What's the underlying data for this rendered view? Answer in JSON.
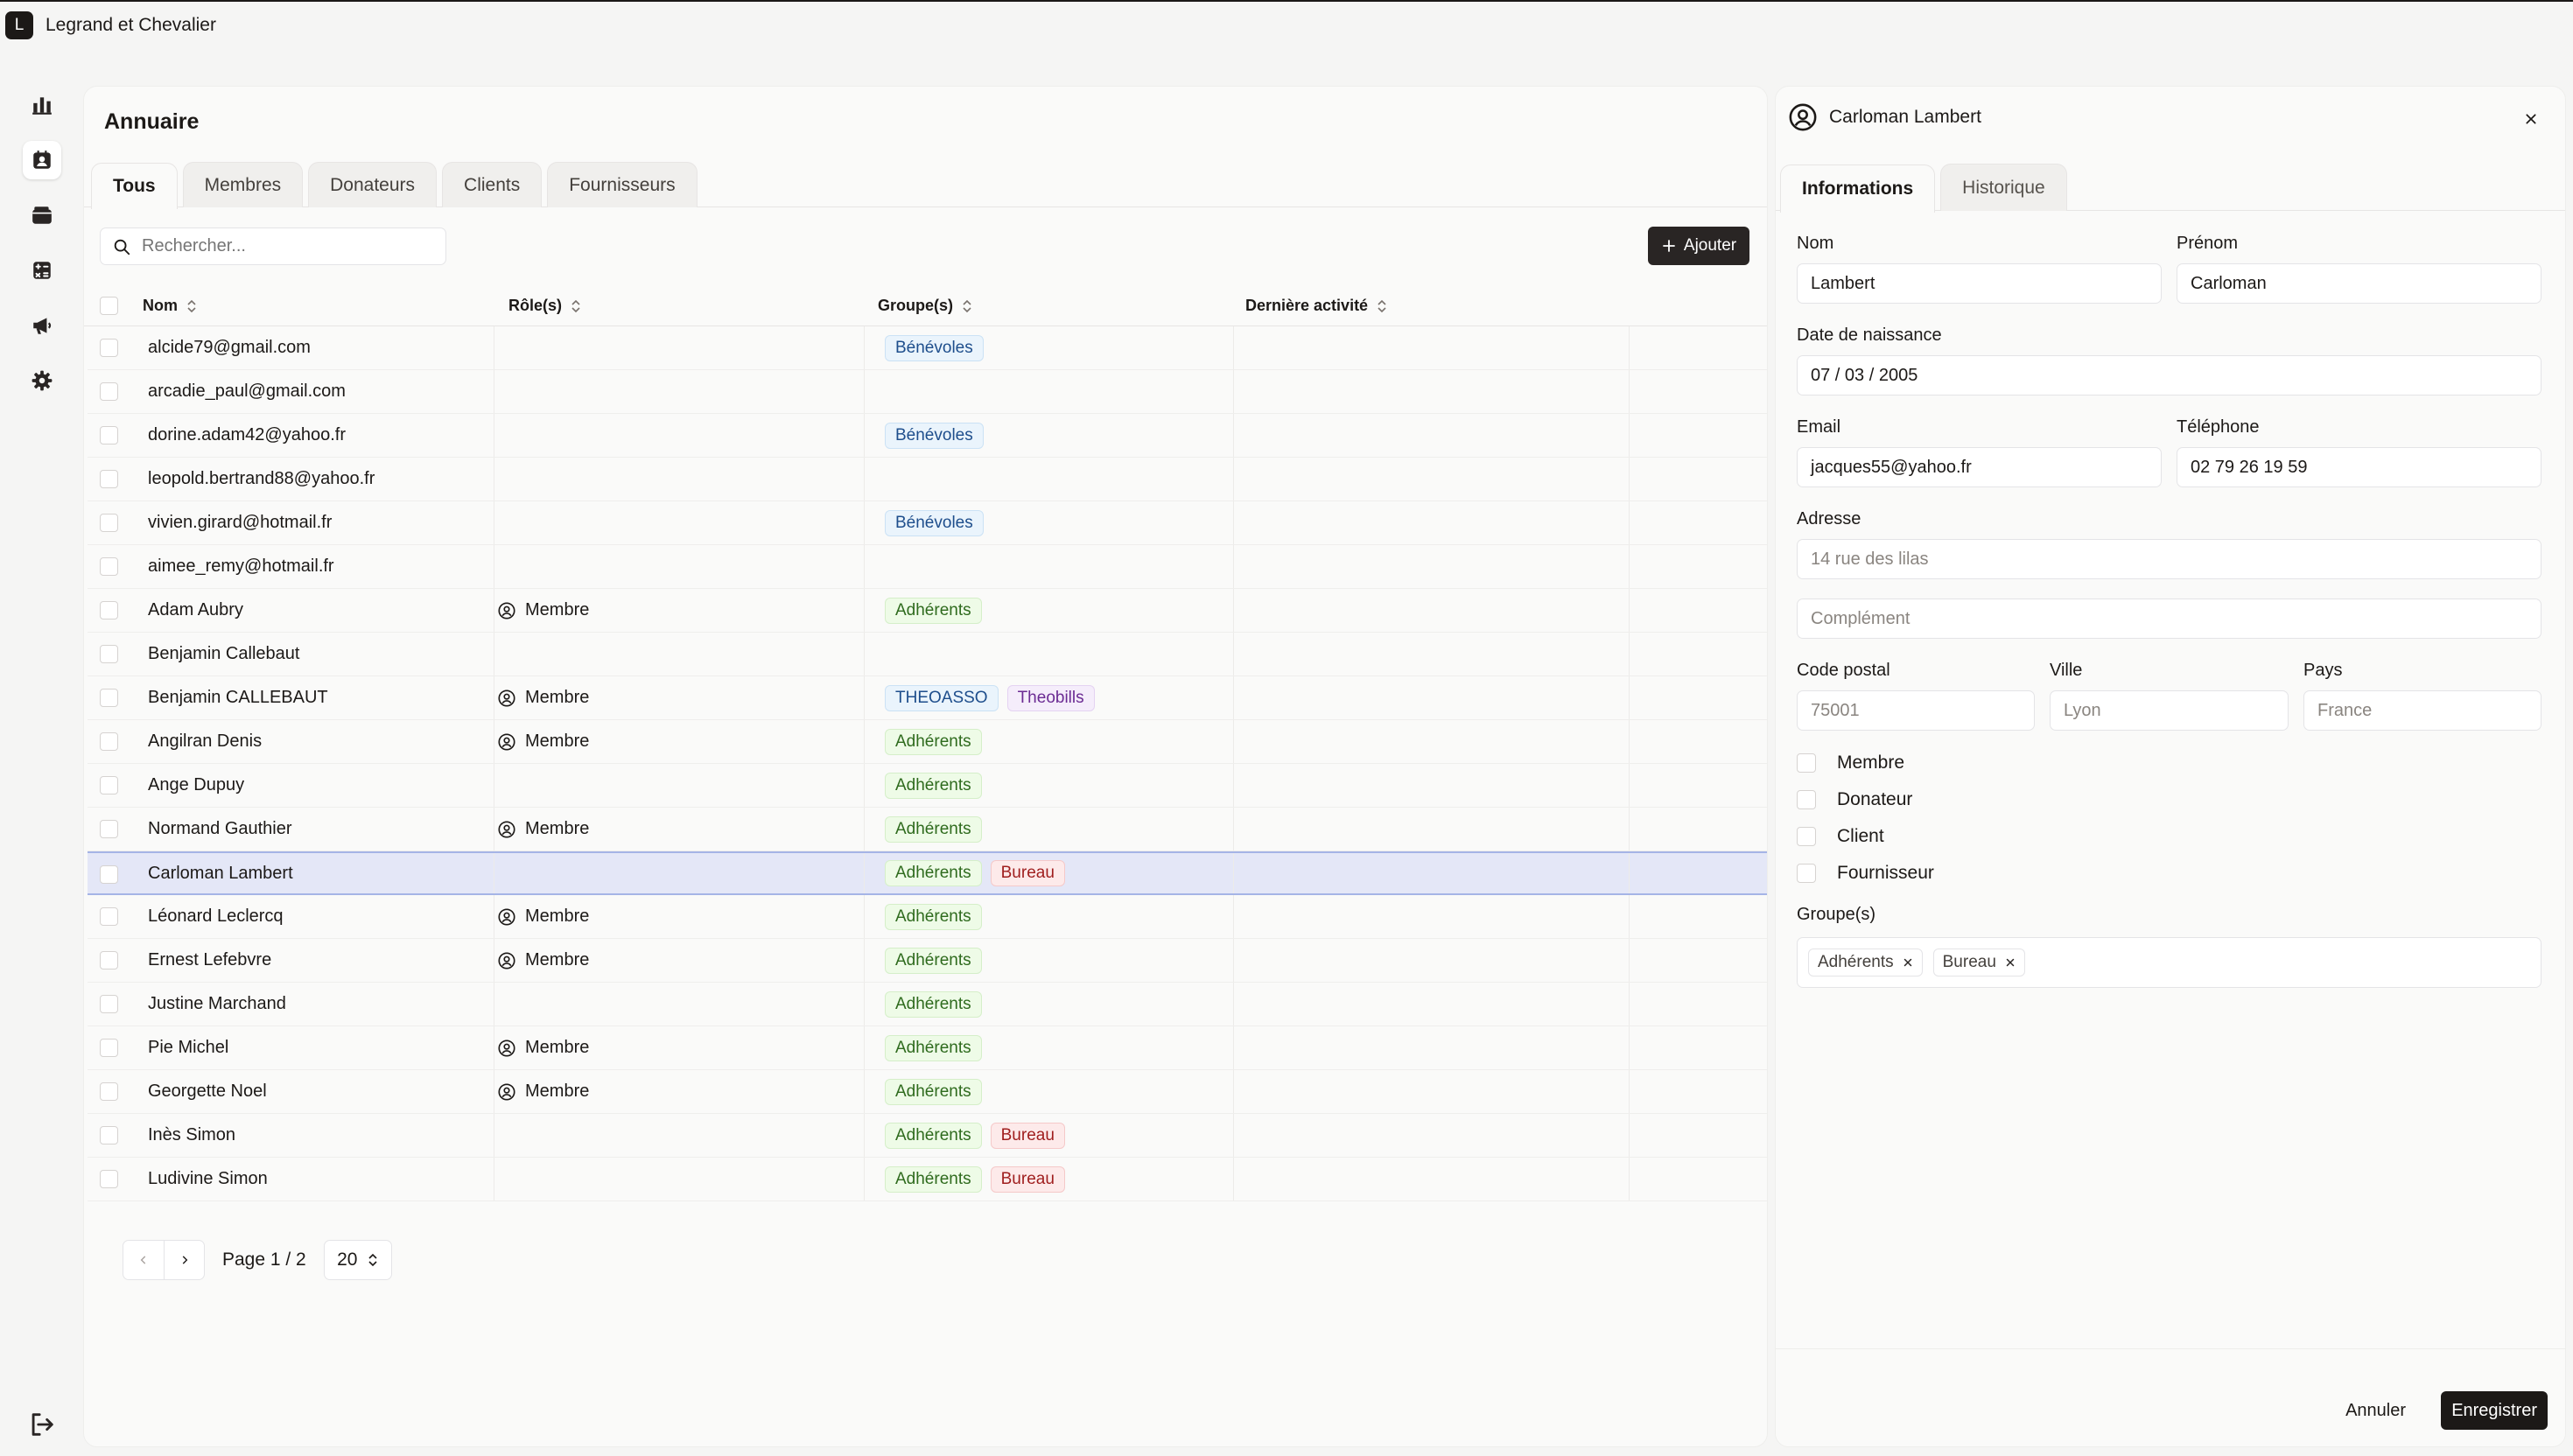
{
  "app": {
    "logo_letter": "L",
    "name": "Legrand et Chevalier"
  },
  "sidebar": {
    "items": [
      {
        "icon": "bar-chart-icon"
      },
      {
        "icon": "contacts-icon",
        "active": true
      },
      {
        "icon": "wallet-icon"
      },
      {
        "icon": "calculator-icon"
      },
      {
        "icon": "megaphone-icon"
      },
      {
        "icon": "gear-icon"
      }
    ],
    "logout_icon": "logout-icon"
  },
  "directory": {
    "title": "Annuaire",
    "tabs": [
      "Tous",
      "Membres",
      "Donateurs",
      "Clients",
      "Fournisseurs"
    ],
    "active_tab": "Tous",
    "search_placeholder": "Rechercher...",
    "add_label": "Ajouter",
    "columns": [
      "Nom",
      "Rôle(s)",
      "Groupe(s)",
      "Dernière activité"
    ],
    "rows": [
      {
        "name": "alcide79@gmail.com",
        "role": "",
        "groups": [
          {
            "label": "Bénévoles",
            "kind": "benevoles"
          }
        ]
      },
      {
        "name": "arcadie_paul@gmail.com",
        "role": "",
        "groups": []
      },
      {
        "name": "dorine.adam42@yahoo.fr",
        "role": "",
        "groups": [
          {
            "label": "Bénévoles",
            "kind": "benevoles"
          }
        ]
      },
      {
        "name": "leopold.bertrand88@yahoo.fr",
        "role": "",
        "groups": []
      },
      {
        "name": "vivien.girard@hotmail.fr",
        "role": "",
        "groups": [
          {
            "label": "Bénévoles",
            "kind": "benevoles"
          }
        ]
      },
      {
        "name": "aimee_remy@hotmail.fr",
        "role": "",
        "groups": []
      },
      {
        "name": "Adam Aubry",
        "role": "Membre",
        "groups": [
          {
            "label": "Adhérents",
            "kind": "adherents"
          }
        ]
      },
      {
        "name": "Benjamin Callebaut",
        "role": "",
        "groups": []
      },
      {
        "name": "Benjamin CALLEBAUT",
        "role": "Membre",
        "groups": [
          {
            "label": "THEOASSO",
            "kind": "theoasso"
          },
          {
            "label": "Theobills",
            "kind": "theobills"
          }
        ]
      },
      {
        "name": "Angilran Denis",
        "role": "Membre",
        "groups": [
          {
            "label": "Adhérents",
            "kind": "adherents"
          }
        ]
      },
      {
        "name": "Ange Dupuy",
        "role": "",
        "groups": [
          {
            "label": "Adhérents",
            "kind": "adherents"
          }
        ]
      },
      {
        "name": "Normand Gauthier",
        "role": "Membre",
        "groups": [
          {
            "label": "Adhérents",
            "kind": "adherents"
          }
        ]
      },
      {
        "name": "Carloman Lambert",
        "role": "",
        "selected": true,
        "groups": [
          {
            "label": "Adhérents",
            "kind": "adherents"
          },
          {
            "label": "Bureau",
            "kind": "bureau"
          }
        ]
      },
      {
        "name": "Léonard Leclercq",
        "role": "Membre",
        "groups": [
          {
            "label": "Adhérents",
            "kind": "adherents"
          }
        ]
      },
      {
        "name": "Ernest Lefebvre",
        "role": "Membre",
        "groups": [
          {
            "label": "Adhérents",
            "kind": "adherents"
          }
        ]
      },
      {
        "name": "Justine Marchand",
        "role": "",
        "groups": [
          {
            "label": "Adhérents",
            "kind": "adherents"
          }
        ]
      },
      {
        "name": "Pie Michel",
        "role": "Membre",
        "groups": [
          {
            "label": "Adhérents",
            "kind": "adherents"
          }
        ]
      },
      {
        "name": "Georgette Noel",
        "role": "Membre",
        "groups": [
          {
            "label": "Adhérents",
            "kind": "adherents"
          }
        ]
      },
      {
        "name": "Inès Simon",
        "role": "",
        "groups": [
          {
            "label": "Adhérents",
            "kind": "adherents"
          },
          {
            "label": "Bureau",
            "kind": "bureau"
          }
        ]
      },
      {
        "name": "Ludivine Simon",
        "role": "",
        "groups": [
          {
            "label": "Adhérents",
            "kind": "adherents"
          },
          {
            "label": "Bureau",
            "kind": "bureau"
          }
        ]
      }
    ],
    "pagination": {
      "label": "Page 1 / 2",
      "page_size": "20"
    }
  },
  "panel": {
    "title": "Carloman Lambert",
    "tabs": [
      "Informations",
      "Historique"
    ],
    "active_tab": "Informations",
    "labels": {
      "nom": "Nom",
      "prenom": "Prénom",
      "birth": "Date de naissance",
      "email": "Email",
      "phone": "Téléphone",
      "address": "Adresse",
      "postal": "Code postal",
      "city": "Ville",
      "country": "Pays",
      "groups": "Groupe(s)"
    },
    "values": {
      "nom": "Lambert",
      "prenom": "Carloman",
      "birth": "07 / 03 / 2005",
      "email": "jacques55@yahoo.fr",
      "phone": "02 79 26 19 59"
    },
    "placeholders": {
      "address": "14 rue des lilas",
      "complement": "Complément",
      "postal": "75001",
      "city": "Lyon",
      "country": "France"
    },
    "role_checks": [
      {
        "label": "Membre",
        "checked": false
      },
      {
        "label": "Donateur",
        "checked": false
      },
      {
        "label": "Client",
        "checked": false
      },
      {
        "label": "Fournisseur",
        "checked": false
      }
    ],
    "selected_groups": [
      "Adhérents",
      "Bureau"
    ],
    "cancel_label": "Annuler",
    "save_label": "Enregistrer"
  }
}
